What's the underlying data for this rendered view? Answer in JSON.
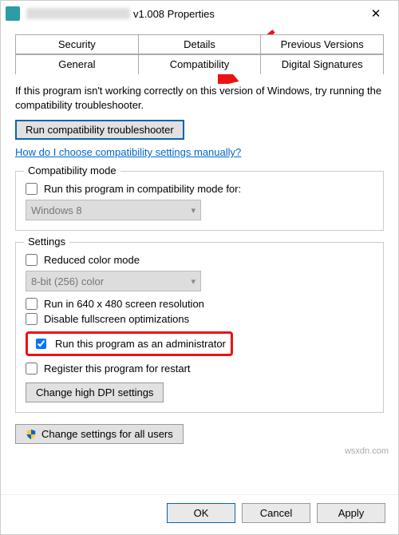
{
  "window": {
    "title_suffix": "v1.008 Properties",
    "close": "✕"
  },
  "tabs": {
    "row1": [
      "Security",
      "Details",
      "Previous Versions"
    ],
    "row2": [
      "General",
      "Compatibility",
      "Digital Signatures"
    ],
    "active": "Compatibility"
  },
  "desc": "If this program isn't working correctly on this version of Windows, try running the compatibility troubleshooter.",
  "run_troubleshooter": "Run compatibility troubleshooter",
  "help_link": "How do I choose compatibility settings manually?",
  "compat_mode": {
    "legend": "Compatibility mode",
    "check_label": "Run this program in compatibility mode for:",
    "checked": false,
    "select_value": "Windows 8"
  },
  "settings": {
    "legend": "Settings",
    "reduced_color": {
      "label": "Reduced color mode",
      "checked": false
    },
    "color_select": "8-bit (256) color",
    "run_640": {
      "label": "Run in 640 x 480 screen resolution",
      "checked": false
    },
    "disable_fullscreen": {
      "label": "Disable fullscreen optimizations",
      "checked": false
    },
    "run_admin": {
      "label": "Run this program as an administrator",
      "checked": true
    },
    "register_restart": {
      "label": "Register this program for restart",
      "checked": false
    },
    "high_dpi": "Change high DPI settings"
  },
  "all_users": "Change settings for all users",
  "footer": {
    "ok": "OK",
    "cancel": "Cancel",
    "apply": "Apply"
  },
  "watermark": "wsxdn.com"
}
